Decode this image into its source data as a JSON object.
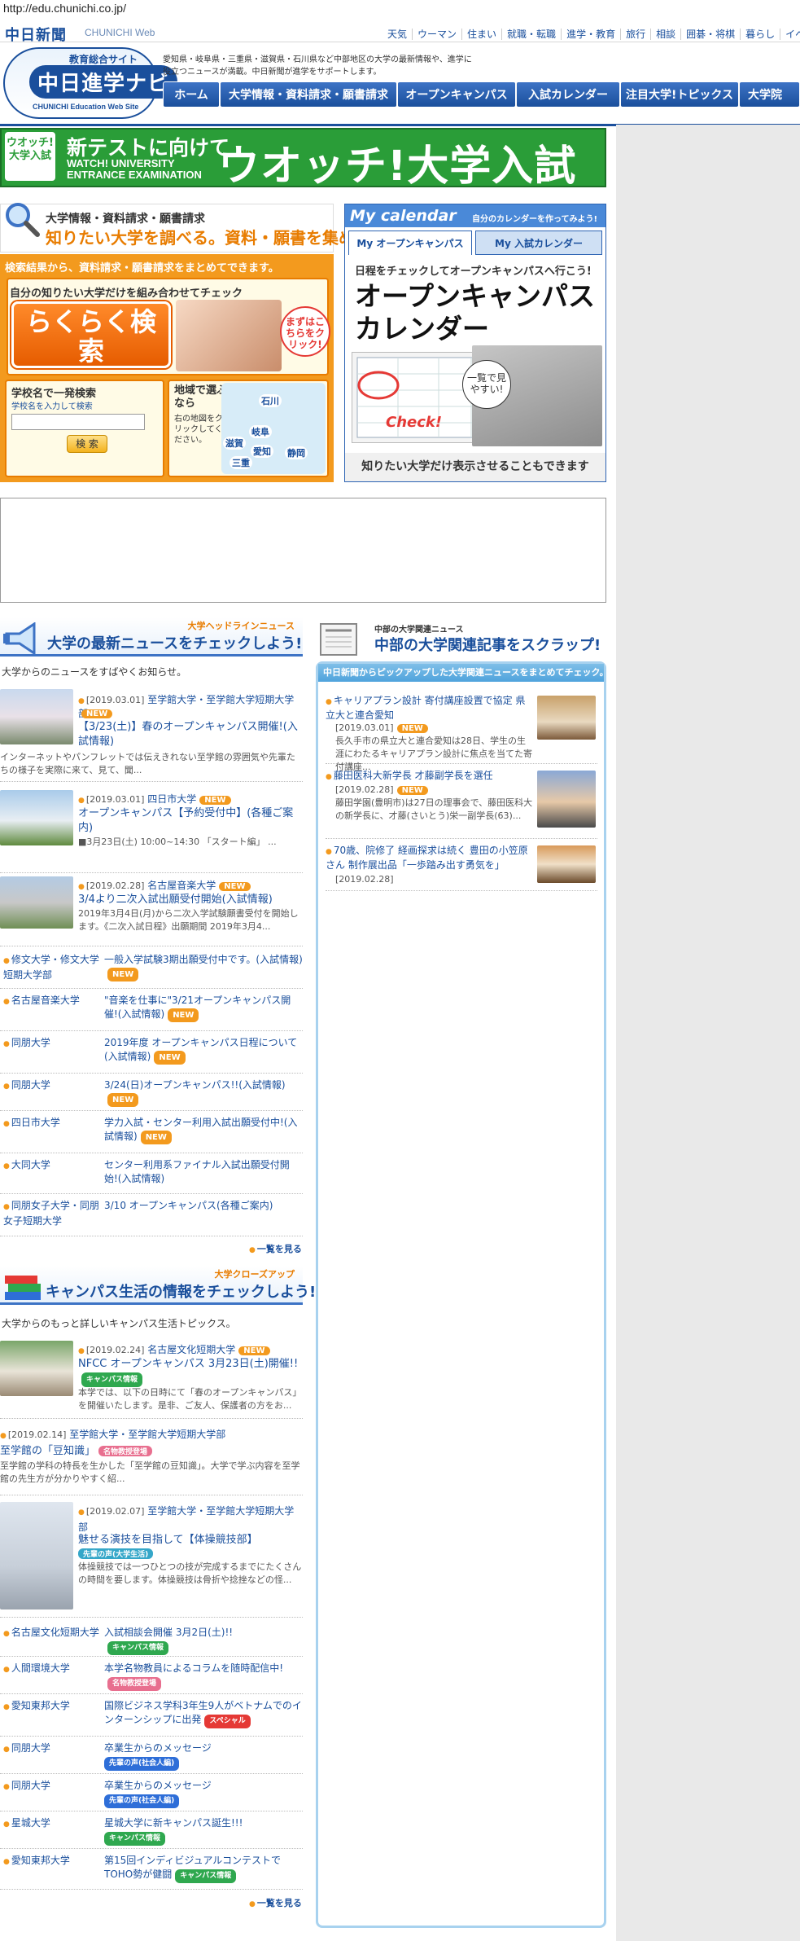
{
  "url": "http://edu.chunichi.co.jp/",
  "top": {
    "logo": "中日新聞",
    "logo_web": "CHUNICHI Web",
    "nav": [
      "天気",
      "ウーマン",
      "住まい",
      "就職・転職",
      "進学・教育",
      "旅行",
      "相談",
      "囲碁・将棋",
      "暮らし",
      "イベ"
    ]
  },
  "header": {
    "sub": "教育総合サイト",
    "title": "中日進学ナビ",
    "en": "CHUNICHI Education Web Site",
    "intro": "愛知県・岐阜県・三重県・滋賀県・石川県など中部地区の大学の最新情報や、進学に役立つニュースが満載。中日新聞が進学をサポートします。",
    "gnav": [
      "ホーム",
      "大学情報・資料請求・願書請求",
      "オープンキャンパス",
      "入試カレンダー",
      "注目大学!トピックス",
      "大学院"
    ]
  },
  "banner": {
    "badge": "ウオッチ!大学入試",
    "line1": "新テストに向けて",
    "line2": "WATCH! UNIVERSITY ENTRANCE EXAMINATION",
    "big": "ウオッチ!大学入試"
  },
  "search": {
    "line1": "大学情報・資料請求・願書請求",
    "line2": "知りたい大学を調べる。資料・願書を集める。",
    "note": "検索結果から、資料請求・願書請求をまとめてできます。",
    "raku_head": "自分の知りたい大学だけを組み合わせてチェック",
    "raku_btn": "らくらく検索",
    "raku_bubble": "まずはこちらをクリック!",
    "school_head": "学校名で一発検索",
    "school_sub": "学校名を入力して検索",
    "school_btn": "検 索",
    "area_head": "地域で選ぶなら",
    "area_sub": "右の地図をクリックしてください。",
    "prefs": [
      "石川",
      "岐阜",
      "滋賀",
      "愛知",
      "静岡",
      "三重"
    ]
  },
  "calendar": {
    "title": "My calendar",
    "sub": "自分のカレンダーを作ってみよう!",
    "tab1": "My オープンキャンパス",
    "tab2": "My 入試カレンダー",
    "line1": "日程をチェックしてオープンキャンパスへ行こう!",
    "big": "オープンキャンパスカレンダー",
    "bubble": "一覧で見やすい!",
    "check": "Check!",
    "foot": "知りたい大学だけ表示させることもできます"
  },
  "news": {
    "tag": "大学ヘッドラインニュース",
    "title": "大学の最新ニュースをチェックしよう!",
    "desc": "大学からのニュースをすばやくお知らせ。",
    "new_label": "NEW",
    "featured": [
      {
        "date": "[2019.03.01]",
        "inst": "至学館大学・至学館大学短期大学部",
        "title": "【3/23(土)】春のオープンキャンパス開催!(入試情報)",
        "body": "インターネットやパンフレットでは伝えきれない至学館の雰囲気や先輩たちの様子を実際に来て、見て、聞..."
      },
      {
        "date": "[2019.03.01]",
        "inst": "四日市大学",
        "title": "オープンキャンパス【予約受付中】(各種ご案内)",
        "body": "■3月23日(土) 10:00~14:30 「スタート編」 ..."
      },
      {
        "date": "[2019.02.28]",
        "inst": "名古屋音楽大学",
        "title": "3/4より二次入試出願受付開始(入試情報)",
        "body": "2019年3月4日(月)から二次入学試験願書受付を開始します。《二次入試日程》出願期間 2019年3月4..."
      }
    ],
    "rows": [
      {
        "univ": "修文大学・修文大学短期大学部",
        "title": "一般入学試験3期出願受付中です。(入試情報)",
        "new": true
      },
      {
        "univ": "名古屋音楽大学",
        "title": "\"音楽を仕事に\"3/21オープンキャンパス開催!(入試情報)",
        "new": true
      },
      {
        "univ": "同朋大学",
        "title": "2019年度 オープンキャンパス日程について(入試情報)",
        "new": true
      },
      {
        "univ": "同朋大学",
        "title": "3/24(日)オープンキャンパス!!(入試情報)",
        "new": true
      },
      {
        "univ": "四日市大学",
        "title": "学力入試・センター利用入試出願受付中!(入試情報)",
        "new": true
      },
      {
        "univ": "大同大学",
        "title": "センター利用系ファイナル入試出願受付開始!(入試情報)",
        "new": false
      },
      {
        "univ": "同朋女子大学・同朋女子短期大学",
        "title": "3/10 オープンキャンパス(各種ご案内)",
        "new": false
      }
    ],
    "more": "一覧を見る"
  },
  "campus": {
    "tag": "大学クローズアップ",
    "title": "キャンパス生活の情報をチェックしよう!",
    "desc": "大学からのもっと詳しいキャンパス生活トピックス。",
    "featured": [
      {
        "date": "[2019.02.24]",
        "inst": "名古屋文化短期大学",
        "title": "NFCC オープンキャンパス 3月23日(土)開催!!",
        "tag": "キャンパス情報",
        "tagcolor": "#2fa84f",
        "body": "本学では、以下の日時にて「春のオープンキャンパス」を開催いたします。是非、ご友人、保護者の方をお..."
      },
      {
        "date": "[2019.02.14]",
        "inst": "至学館大学・至学館大学短期大学部",
        "title": "至学館の「豆知識」",
        "tag": "名物教授登場",
        "tagcolor": "#e86f8f",
        "body": "至学館の学科の特長を生かした「至学館の豆知識」。大学で学ぶ内容を至学館の先生方が分かりやすく紹..."
      },
      {
        "date": "[2019.02.07]",
        "inst": "至学館大学・至学館大学短期大学部",
        "title": "魅せる演技を目指して【体操競技部】",
        "tag": "先輩の声(大学生活)",
        "tagcolor": "#35a7c9",
        "body": "体操競技では一つひとつの技が完成するまでにたくさんの時間を要します。体操競技は骨折や捻挫などの怪..."
      }
    ],
    "rows": [
      {
        "univ": "名古屋文化短期大学",
        "title": "入試相談会開催 3月2日(土)!!",
        "tag": "キャンパス情報",
        "tagcolor": "#2fa84f"
      },
      {
        "univ": "人間環境大学",
        "title": "本学名物教員によるコラムを随時配信中!",
        "tag": "名物教授登場",
        "tagcolor": "#e86f8f"
      },
      {
        "univ": "愛知東邦大学",
        "title": "国際ビジネス学科3年生9人がベトナムでのインターンシップに出発",
        "tag": "スペシャル",
        "tagcolor": "#e53935"
      },
      {
        "univ": "同朋大学",
        "title": "卒業生からのメッセージ",
        "tag": "先輩の声(社会人編)",
        "tagcolor": "#2e6ed8"
      },
      {
        "univ": "同朋大学",
        "title": "卒業生からのメッセージ",
        "tag": "先輩の声(社会人編)",
        "tagcolor": "#2e6ed8"
      },
      {
        "univ": "星城大学",
        "title": "星城大学に新キャンパス誕生!!!",
        "tag": "キャンパス情報",
        "tagcolor": "#2fa84f"
      },
      {
        "univ": "愛知東邦大学",
        "title": "第15回インディビジュアルコンテストでTOHO勢が健闘",
        "tag": "キャンパス情報",
        "tagcolor": "#2fa84f"
      }
    ],
    "more": "一覧を見る"
  },
  "clip": {
    "tag": "中部の大学関連ニュース",
    "title": "中部の大学関連記事をスクラップ!",
    "bar": "中日新聞からピックアップした大学関連ニュースをまとめてチェック。",
    "items": [
      {
        "title": "キャリアプラン設計 寄付講座設置で協定 県立大と連合愛知",
        "date": "[2019.03.01]",
        "new": true,
        "body": "長久手市の県立大と連合愛知は28日、学生の生涯にわたるキャリアプラン設計に焦点を当てた寄付講座..."
      },
      {
        "title": "藤田医科大新学長 才藤副学長を選任",
        "date": "[2019.02.28]",
        "new": true,
        "body": "藤田学園(豊明市)は27日の理事会で、藤田医科大の新学長に、才藤(さいとう)栄一副学長(63)..."
      },
      {
        "title": "70歳、院修了 経画探求は続く 豊田の小笠原さん 制作展出品「一歩踏み出す勇気を」",
        "date": "[2019.02.28]",
        "new": false,
        "body": ""
      }
    ]
  }
}
